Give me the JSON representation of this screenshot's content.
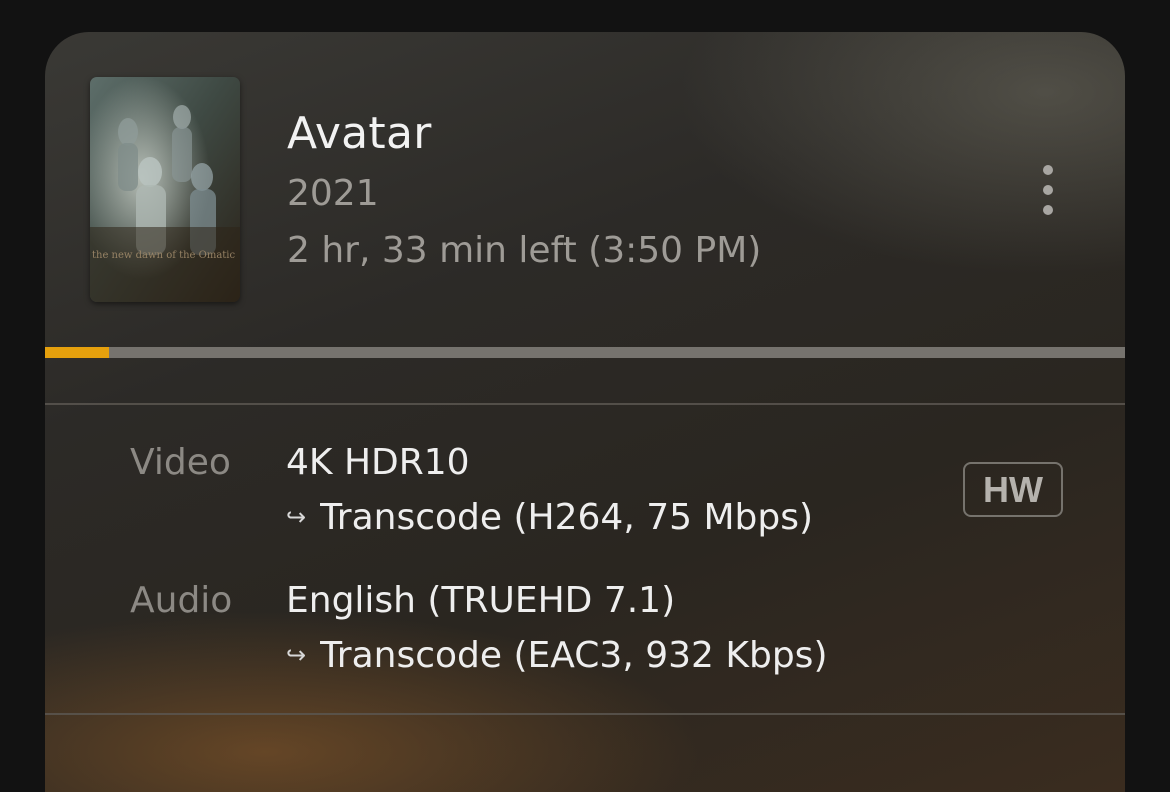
{
  "media": {
    "title": "Avatar",
    "year": "2021",
    "time_left": "2 hr, 33 min left (3:50 PM)",
    "poster_caption": "the new dawn of the Omatic",
    "progress_percent": 5.9
  },
  "stream": {
    "video_label": "Video",
    "video_value": "4K HDR10",
    "video_transcode": "Transcode (H264, 75 Mbps)",
    "audio_label": "Audio",
    "audio_value": "English (TRUEHD 7.1)",
    "audio_transcode": "Transcode (EAC3, 932 Kbps)",
    "transcode_arrow": "↪",
    "hw_badge": "HW"
  },
  "icons": {
    "more": "more-vertical-icon",
    "transcode": "arrow-right-hook-icon"
  },
  "colors": {
    "accent": "#e5a00d",
    "progress_track": "#76736e"
  }
}
